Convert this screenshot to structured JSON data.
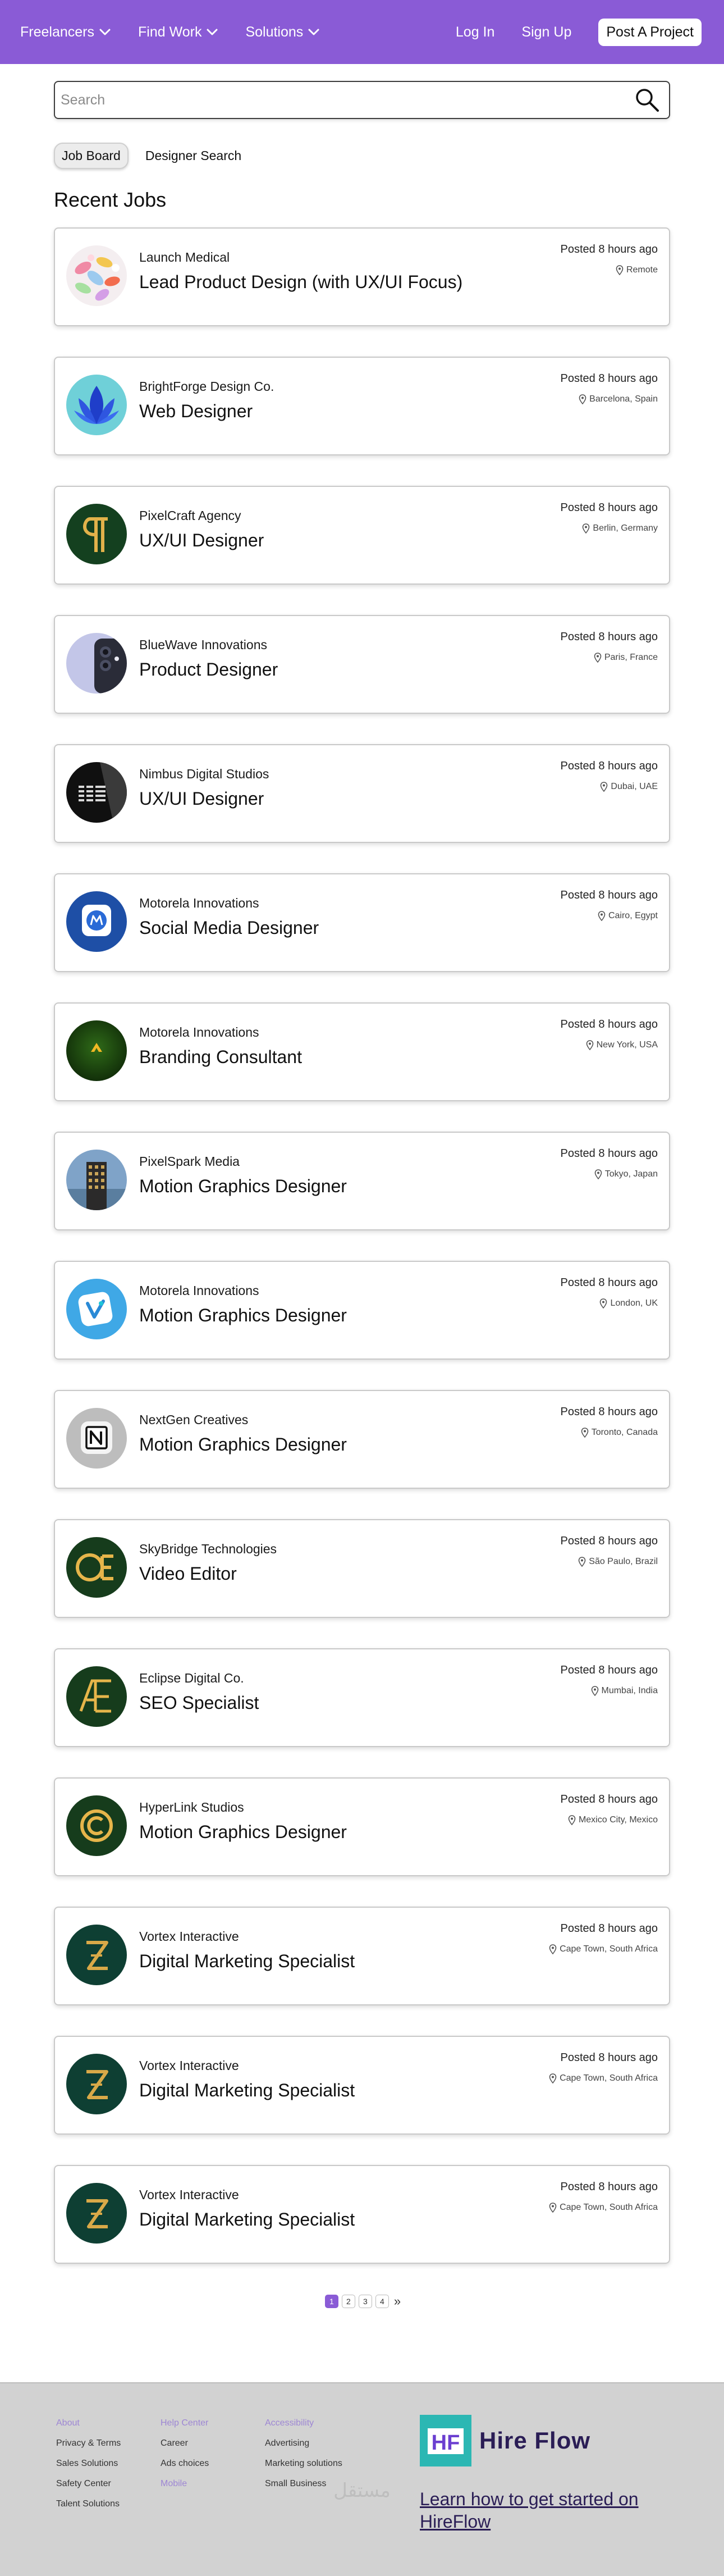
{
  "nav": {
    "left": [
      {
        "label": "Freelancers"
      },
      {
        "label": "Find Work"
      },
      {
        "label": "Solutions"
      }
    ],
    "login": "Log In",
    "signup": "Sign Up",
    "post_project": "Post A Project"
  },
  "search": {
    "placeholder": "Search"
  },
  "tabs": [
    "Job Board",
    "Designer Search"
  ],
  "section_title": "Recent Jobs",
  "jobs": [
    {
      "company": "Launch Medical",
      "title": "Lead Product Design (with UX/UI Focus)",
      "posted": "Posted 8 hours ago",
      "location": "Remote",
      "logo": "pills-logo"
    },
    {
      "company": "BrightForge Design Co.",
      "title": "Web Designer",
      "posted": "Posted 8 hours ago",
      "location": "Barcelona, Spain",
      "logo": "leaf-logo"
    },
    {
      "company": "PixelCraft Agency",
      "title": "UX/UI Designer",
      "posted": "Posted 8 hours ago",
      "location": "Berlin, Germany",
      "logo": "pilcrow-logo"
    },
    {
      "company": "BlueWave Innovations",
      "title": " Product Designer",
      "posted": "Posted 8 hours ago",
      "location": "Paris, France",
      "logo": "phone-logo"
    },
    {
      "company": "Nimbus Digital Studios",
      "title": "UX/UI Designer",
      "posted": "Posted 8 hours ago",
      "location": "Dubai, UAE",
      "logo": "ibm-logo"
    },
    {
      "company": "Motorela Innovations",
      "title": "Social Media Designer",
      "posted": "Posted 8 hours ago",
      "location": "Cairo, Egypt",
      "logo": "motorola-app-logo"
    },
    {
      "company": "Motorela Innovations",
      "title": "Branding Consultant",
      "posted": "Posted 8 hours ago",
      "location": "New York, USA",
      "logo": "caret-logo"
    },
    {
      "company": "PixelSpark Media",
      "title": "Motion Graphics Designer",
      "posted": "Posted 8 hours ago",
      "location": "Tokyo, Japan",
      "logo": "building-logo"
    },
    {
      "company": "Motorela Innovations",
      "title": "Motion Graphics Designer",
      "posted": "Posted 8 hours ago",
      "location": "London, UK",
      "logo": "v-app-logo"
    },
    {
      "company": "NextGen Creatives",
      "title": "Motion Graphics Designer",
      "posted": "Posted 8 hours ago",
      "location": "Toronto, Canada",
      "logo": "notion-logo"
    },
    {
      "company": "SkyBridge Technologies",
      "title": "Video Editor",
      "posted": "Posted 8 hours ago",
      "location": "São Paulo, Brazil",
      "logo": "oe-logo"
    },
    {
      "company": "Eclipse Digital Co.",
      "title": "SEO Specialist",
      "posted": "Posted 8 hours ago",
      "location": "Mumbai, India",
      "logo": "ae-logo"
    },
    {
      "company": "HyperLink Studios",
      "title": "Motion Graphics Designer",
      "posted": "Posted 8 hours ago",
      "location": "Mexico City, Mexico",
      "logo": "c-logo"
    },
    {
      "company": "Vortex Interactive",
      "title": "Digital Marketing Specialist",
      "posted": "Posted 8 hours ago",
      "location": "Cape Town, South Africa",
      "logo": "z-logo"
    },
    {
      "company": "Vortex Interactive",
      "title": "Digital Marketing Specialist",
      "posted": "Posted 8 hours ago",
      "location": "Cape Town, South Africa",
      "logo": "z-logo"
    },
    {
      "company": "Vortex Interactive",
      "title": "Digital Marketing Specialist",
      "posted": "Posted 8 hours ago",
      "location": "Cape Town, South Africa",
      "logo": "z-logo"
    }
  ],
  "pagination": {
    "pages": [
      "1",
      "2",
      "3",
      "4"
    ],
    "current": "1",
    "next": "»"
  },
  "footer": {
    "col1": [
      "About",
      "Privacy & Terms",
      "Sales Solutions",
      "Safety Center",
      "Talent Solutions"
    ],
    "col2": [
      "Help Center",
      "Career",
      "Ads choices",
      "Mobile"
    ],
    "col3": [
      "Accessibility",
      "Advertising",
      "Marketing solutions",
      "Small Business"
    ],
    "brand_mark": "HF",
    "brand_name": "Hire Flow",
    "learn_link": "Learn how to get started on HireFlow",
    "watermark": "مستقل"
  },
  "colors": {
    "accent": "#8a5bd6",
    "footer_bg": "#d2d2d2",
    "brand_dark": "#2a1d55",
    "brand_teal": "#2bb7b3"
  }
}
